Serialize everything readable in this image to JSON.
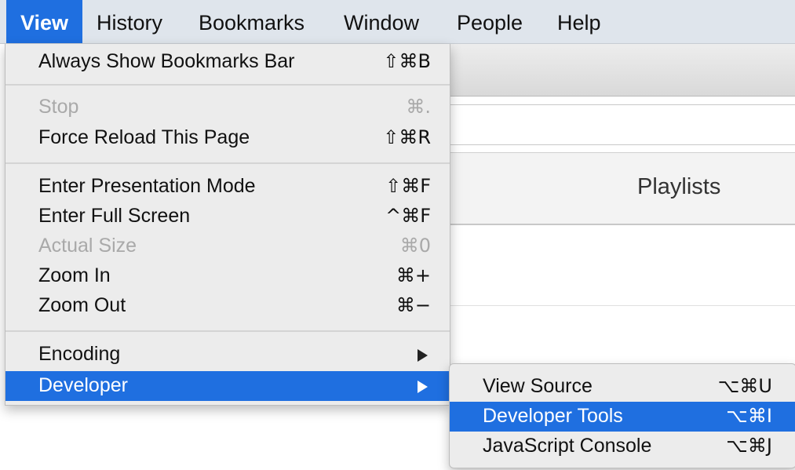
{
  "menubar": {
    "items": [
      "View",
      "History",
      "Bookmarks",
      "Window",
      "People",
      "Help"
    ],
    "active": "View"
  },
  "background": {
    "tab_title": "Playlists"
  },
  "view_menu": {
    "items": [
      {
        "label": "Always Show Bookmarks Bar",
        "shortcut": "⇧⌘B",
        "enabled": true
      },
      {
        "label": "Stop",
        "shortcut": "⌘.",
        "enabled": false
      },
      {
        "label": "Force Reload This Page",
        "shortcut": "⇧⌘R",
        "enabled": true
      },
      {
        "label": "Enter Presentation Mode",
        "shortcut": "⇧⌘F",
        "enabled": true
      },
      {
        "label": "Enter Full Screen",
        "shortcut": "^⌘F",
        "enabled": true
      },
      {
        "label": "Actual Size",
        "shortcut": "⌘0",
        "enabled": false
      },
      {
        "label": "Zoom In",
        "shortcut": "⌘+",
        "enabled": true
      },
      {
        "label": "Zoom Out",
        "shortcut": "⌘−",
        "enabled": true
      },
      {
        "label": "Encoding",
        "shortcut": "",
        "enabled": true,
        "submenu": true
      },
      {
        "label": "Developer",
        "shortcut": "",
        "enabled": true,
        "submenu": true,
        "selected": true
      }
    ]
  },
  "developer_menu": {
    "items": [
      {
        "label": "View Source",
        "shortcut": "⌥⌘U"
      },
      {
        "label": "Developer Tools",
        "shortcut": "⌥⌘I",
        "selected": true
      },
      {
        "label": "JavaScript Console",
        "shortcut": "⌥⌘J"
      }
    ]
  },
  "colors": {
    "accent": "#1f6fe0",
    "menubar_bg": "#dfe5ec",
    "menu_bg": "#ececec",
    "disabled_text": "#a9a9a9"
  }
}
